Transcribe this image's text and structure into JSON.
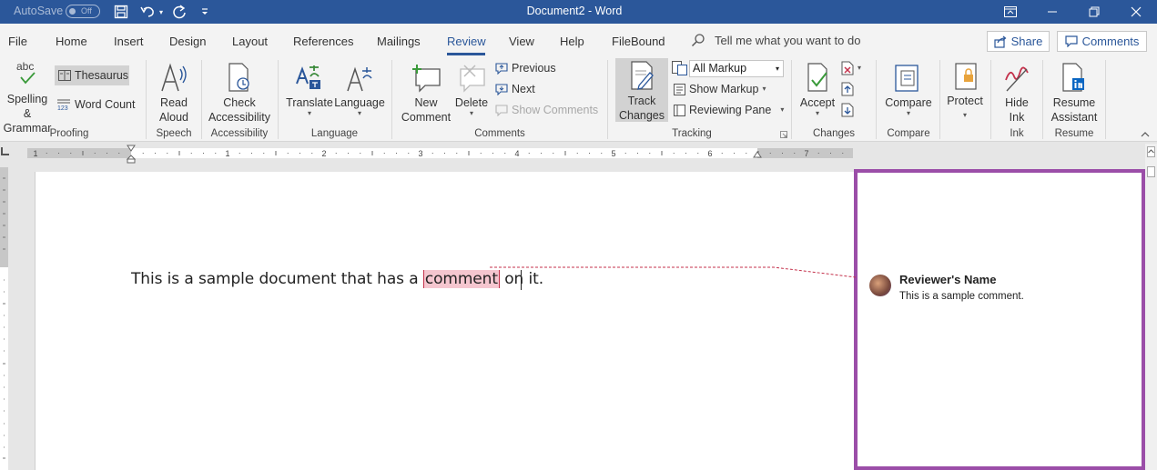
{
  "titlebar": {
    "autosave_label": "AutoSave",
    "autosave_state": "Off",
    "document_title": "Document2  -  Word",
    "quick_access": [
      "save-icon",
      "undo-icon",
      "redo-icon",
      "customize-icon"
    ],
    "window_controls": [
      "ribbon-display-icon",
      "minimize-icon",
      "maximize-icon",
      "close-icon"
    ]
  },
  "tabs": {
    "items": [
      "File",
      "Home",
      "Insert",
      "Design",
      "Layout",
      "References",
      "Mailings",
      "Review",
      "View",
      "Help",
      "FileBound"
    ],
    "active": "Review",
    "tell_me": "Tell me what you want to do",
    "share": "Share",
    "comments": "Comments"
  },
  "ribbon": {
    "proofing": {
      "spelling_line1": "Spelling &",
      "spelling_line2": "Grammar",
      "spelling_icon_text": "abc",
      "thesaurus": "Thesaurus",
      "word_count": "Word Count",
      "word_count_icon_text": "123",
      "group": "Proofing"
    },
    "speech": {
      "read_line1": "Read",
      "read_line2": "Aloud",
      "group": "Speech"
    },
    "accessibility": {
      "check_line1": "Check",
      "check_line2": "Accessibility",
      "group": "Accessibility"
    },
    "language": {
      "translate": "Translate",
      "language": "Language",
      "group": "Language"
    },
    "comments": {
      "new_line1": "New",
      "new_line2": "Comment",
      "delete": "Delete",
      "previous": "Previous",
      "next": "Next",
      "show_comments": "Show Comments",
      "group": "Comments"
    },
    "tracking": {
      "track_line1": "Track",
      "track_line2": "Changes",
      "markup_select": "All Markup",
      "show_markup": "Show Markup",
      "reviewing_pane": "Reviewing Pane",
      "group": "Tracking"
    },
    "changes": {
      "accept": "Accept",
      "group": "Changes"
    },
    "compare": {
      "compare": "Compare",
      "group": "Compare"
    },
    "protect": {
      "protect": "Protect"
    },
    "ink": {
      "hide_line1": "Hide",
      "hide_line2": "Ink",
      "group": "Ink"
    },
    "resume": {
      "resume_line1": "Resume",
      "resume_line2": "Assistant",
      "group": "Resume"
    }
  },
  "ruler": {
    "numbers": [
      "1",
      "1",
      "2",
      "3",
      "4",
      "5",
      "6",
      "7"
    ]
  },
  "document": {
    "text_before": "This is a sample document that has a ",
    "commented_word": "comment",
    "text_after": " on it."
  },
  "comment": {
    "author": "Reviewer's Name",
    "text": "This is a sample comment."
  },
  "colors": {
    "title_bar": "#2b579a",
    "markup_pane_border": "#9b4ea8",
    "comment_highlight": "#f5c6cf",
    "comment_marker": "#c4314b"
  }
}
